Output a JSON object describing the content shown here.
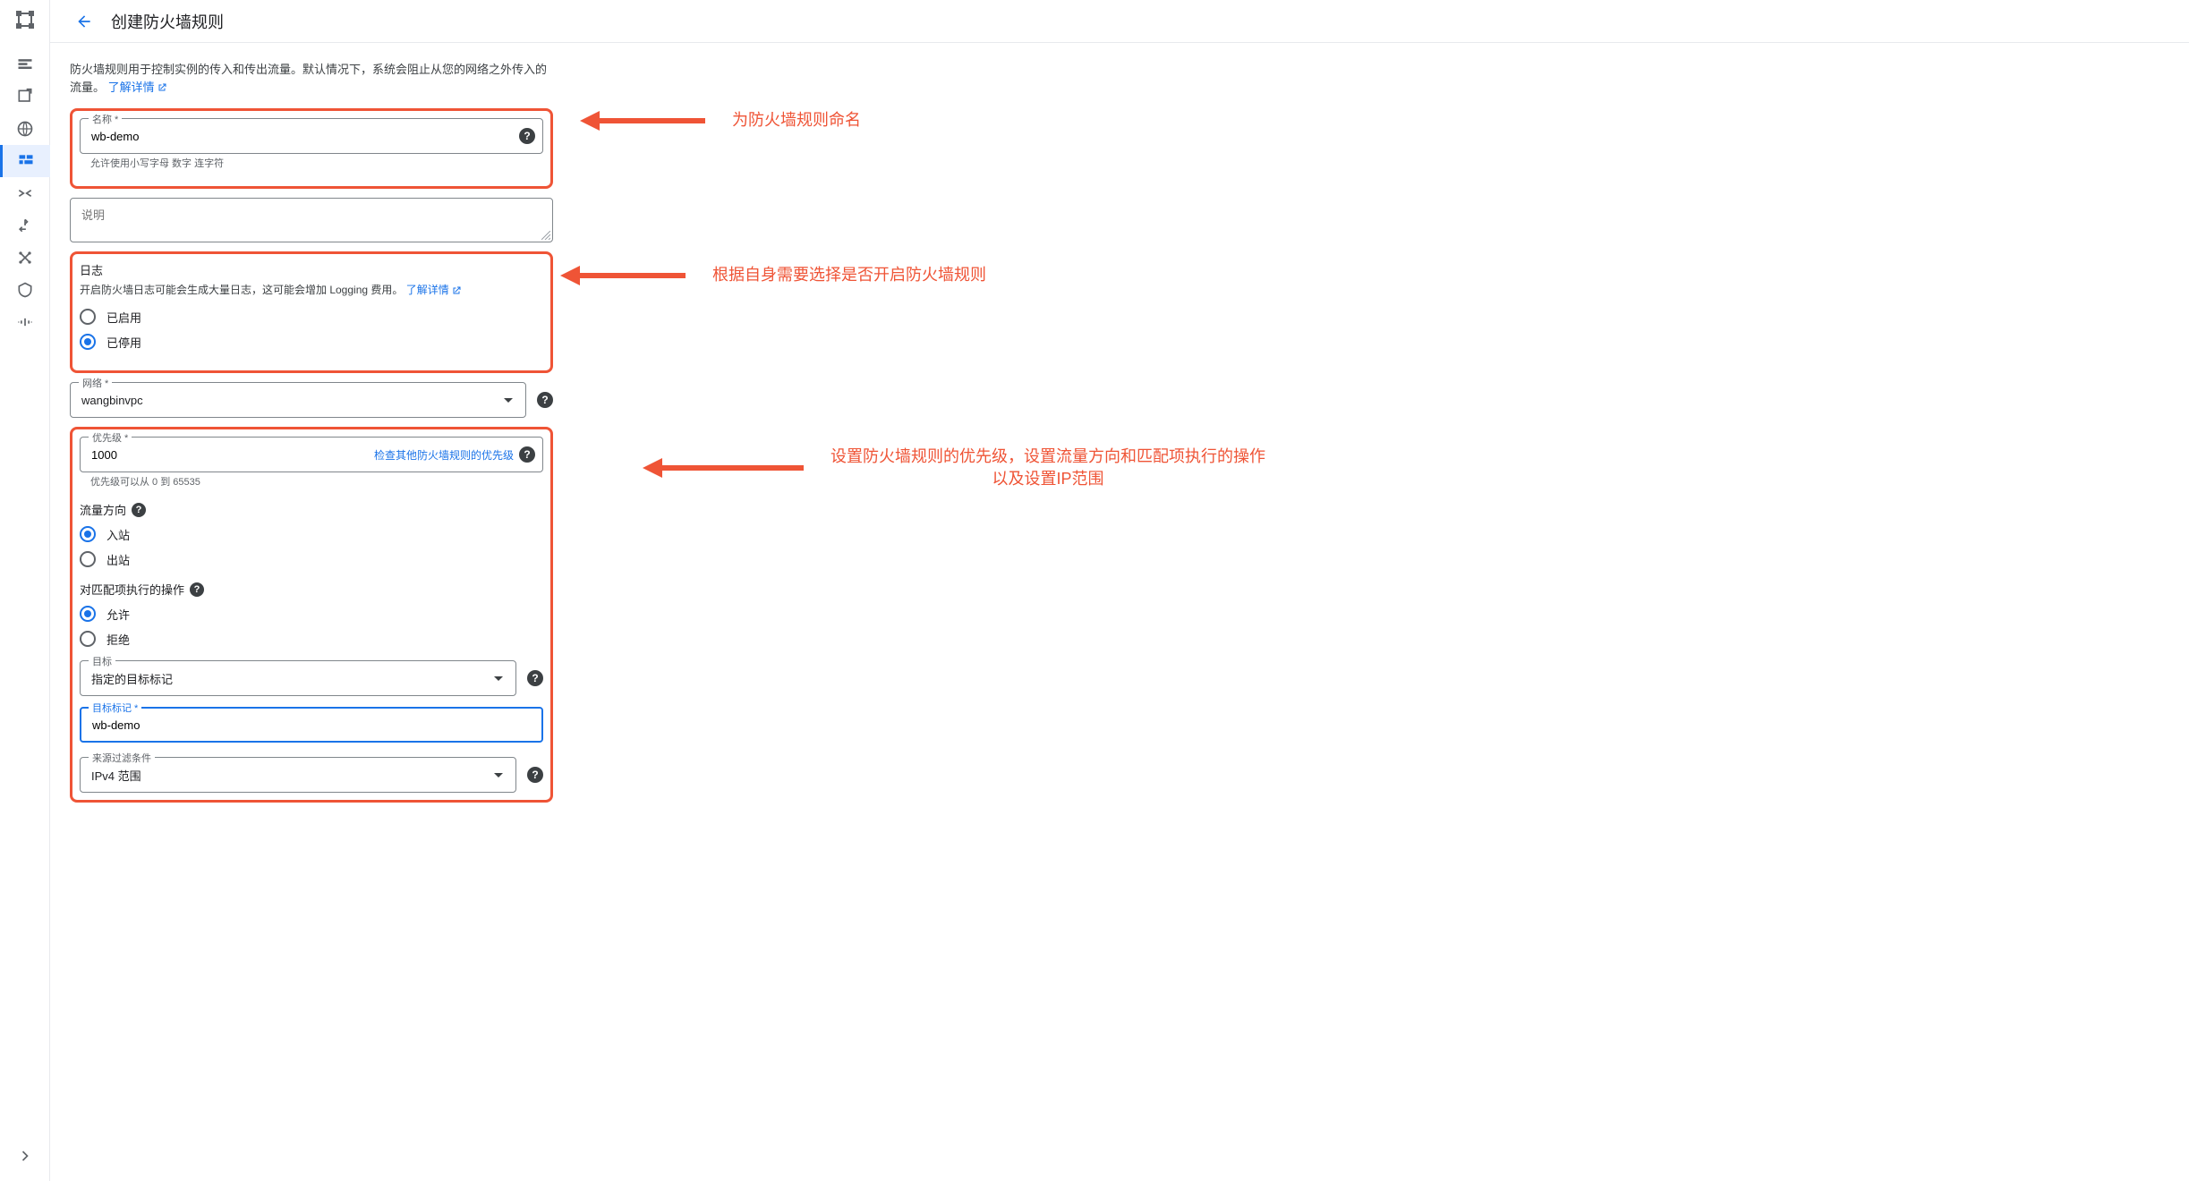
{
  "header": {
    "title": "创建防火墙规则"
  },
  "intro": {
    "text": "防火墙规则用于控制实例的传入和传出流量。默认情况下，系统会阻止从您的网络之外传入的流量。",
    "learn_more": "了解详情"
  },
  "name": {
    "label": "名称 *",
    "value": "wb-demo",
    "hint": "允许使用小写字母   数字   连字符"
  },
  "description": {
    "placeholder": "说明"
  },
  "log": {
    "title": "日志",
    "desc_prefix": "开启防火墙日志可能会生成大量日志，这可能会增加 Logging 费用。",
    "learn_more": "了解详情",
    "opt_enabled": "已启用",
    "opt_disabled": "已停用"
  },
  "network": {
    "label": "网络 *",
    "value": "wangbinvpc"
  },
  "priority": {
    "label": "优先级 *",
    "value": "1000",
    "check_link": "检查其他防火墙规则的优先级",
    "hint": "优先级可以从 0 到 65535"
  },
  "direction": {
    "title": "流量方向",
    "opt_in": "入站",
    "opt_out": "出站"
  },
  "action": {
    "title": "对匹配项执行的操作",
    "opt_allow": "允许",
    "opt_deny": "拒绝"
  },
  "target": {
    "label": "目标",
    "value": "指定的目标标记"
  },
  "target_tag": {
    "label": "目标标记 *",
    "value": "wb-demo"
  },
  "source_filter": {
    "label": "来源过滤条件",
    "value": "IPv4 范围"
  },
  "annotations": {
    "a1": "为防火墙规则命名",
    "a2": "根据自身需要选择是否开启防火墙规则",
    "a3_line1": "设置防火墙规则的优先级，设置流量方向和匹配项执行的操作",
    "a3_line2": "以及设置IP范围"
  }
}
